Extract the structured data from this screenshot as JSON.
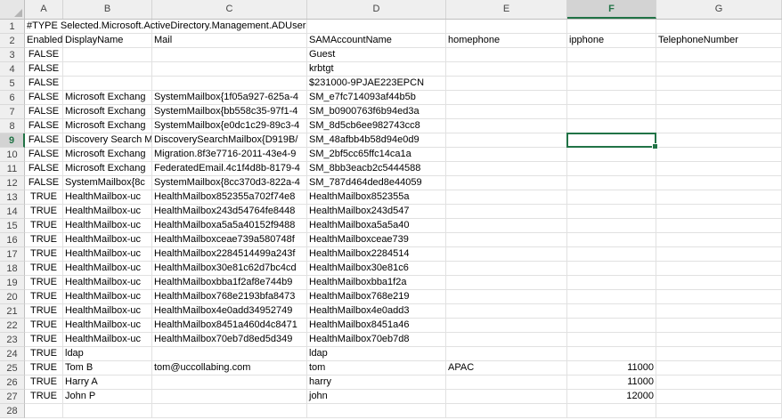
{
  "columns": [
    "A",
    "B",
    "C",
    "D",
    "E",
    "F",
    "G"
  ],
  "selected_cell": {
    "column": "F",
    "row": 9
  },
  "rows": [
    {
      "n": "1",
      "cells": [
        "#TYPE Selected.Microsoft.ActiveDirectory.Management.ADUser",
        "",
        "",
        "",
        "",
        "",
        ""
      ]
    },
    {
      "n": "2",
      "cells": [
        "Enabled",
        "DisplayName",
        "Mail",
        "SAMAccountName",
        "homephone",
        "ipphone",
        "TelephoneNumber"
      ]
    },
    {
      "n": "3",
      "cells": [
        "FALSE",
        "",
        "",
        "Guest",
        "",
        "",
        ""
      ]
    },
    {
      "n": "4",
      "cells": [
        "FALSE",
        "",
        "",
        "krbtgt",
        "",
        "",
        ""
      ]
    },
    {
      "n": "5",
      "cells": [
        "FALSE",
        "",
        "",
        "$231000-9PJAE223EPCN",
        "",
        "",
        ""
      ]
    },
    {
      "n": "6",
      "cells": [
        "FALSE",
        "Microsoft Exchang",
        "SystemMailbox{1f05a927-625a-4",
        "SM_e7fc714093af44b5b",
        "",
        "",
        ""
      ]
    },
    {
      "n": "7",
      "cells": [
        "FALSE",
        "Microsoft Exchang",
        "SystemMailbox{bb558c35-97f1-4",
        "SM_b0900763f6b94ed3a",
        "",
        "",
        ""
      ]
    },
    {
      "n": "8",
      "cells": [
        "FALSE",
        "Microsoft Exchang",
        "SystemMailbox{e0dc1c29-89c3-4",
        "SM_8d5cb6ee982743cc8",
        "",
        "",
        ""
      ]
    },
    {
      "n": "9",
      "cells": [
        "FALSE",
        "Discovery Search M",
        "DiscoverySearchMailbox{D919B/",
        "SM_48afbb4b58d94e0d9",
        "",
        "",
        ""
      ]
    },
    {
      "n": "10",
      "cells": [
        "FALSE",
        "Microsoft Exchang",
        "Migration.8f3e7716-2011-43e4-9",
        "SM_2bf5cc65ffc14ca1a",
        "",
        "",
        ""
      ]
    },
    {
      "n": "11",
      "cells": [
        "FALSE",
        "Microsoft Exchang",
        "FederatedEmail.4c1f4d8b-8179-4",
        "SM_8bb3eacb2c5444588",
        "",
        "",
        ""
      ]
    },
    {
      "n": "12",
      "cells": [
        "FALSE",
        "SystemMailbox{8c",
        "SystemMailbox{8cc370d3-822a-4",
        "SM_787d464ded8e44059",
        "",
        "",
        ""
      ]
    },
    {
      "n": "13",
      "cells": [
        "TRUE",
        "HealthMailbox-uc",
        "HealthMailbox852355a702f74e8",
        "HealthMailbox852355a",
        "",
        "",
        ""
      ]
    },
    {
      "n": "14",
      "cells": [
        "TRUE",
        "HealthMailbox-uc",
        "HealthMailbox243d54764fe8448",
        "HealthMailbox243d547",
        "",
        "",
        ""
      ]
    },
    {
      "n": "15",
      "cells": [
        "TRUE",
        "HealthMailbox-uc",
        "HealthMailboxa5a5a40152f9488",
        "HealthMailboxa5a5a40",
        "",
        "",
        ""
      ]
    },
    {
      "n": "16",
      "cells": [
        "TRUE",
        "HealthMailbox-uc",
        "HealthMailboxceae739a580748f",
        "HealthMailboxceae739",
        "",
        "",
        ""
      ]
    },
    {
      "n": "17",
      "cells": [
        "TRUE",
        "HealthMailbox-uc",
        "HealthMailbox2284514499a243f",
        "HealthMailbox2284514",
        "",
        "",
        ""
      ]
    },
    {
      "n": "18",
      "cells": [
        "TRUE",
        "HealthMailbox-uc",
        "HealthMailbox30e81c62d7bc4cd",
        "HealthMailbox30e81c6",
        "",
        "",
        ""
      ]
    },
    {
      "n": "19",
      "cells": [
        "TRUE",
        "HealthMailbox-uc",
        "HealthMailboxbba1f2af8e744b9",
        "HealthMailboxbba1f2a",
        "",
        "",
        ""
      ]
    },
    {
      "n": "20",
      "cells": [
        "TRUE",
        "HealthMailbox-uc",
        "HealthMailbox768e2193bfa8473",
        "HealthMailbox768e219",
        "",
        "",
        ""
      ]
    },
    {
      "n": "21",
      "cells": [
        "TRUE",
        "HealthMailbox-uc",
        "HealthMailbox4e0add34952749",
        "HealthMailbox4e0add3",
        "",
        "",
        ""
      ]
    },
    {
      "n": "22",
      "cells": [
        "TRUE",
        "HealthMailbox-uc",
        "HealthMailbox8451a460d4c8471",
        "HealthMailbox8451a46",
        "",
        "",
        ""
      ]
    },
    {
      "n": "23",
      "cells": [
        "TRUE",
        "HealthMailbox-uc",
        "HealthMailbox70eb7d8ed5d349",
        "HealthMailbox70eb7d8",
        "",
        "",
        ""
      ]
    },
    {
      "n": "24",
      "cells": [
        "TRUE",
        "ldap",
        "",
        "ldap",
        "",
        "",
        ""
      ]
    },
    {
      "n": "25",
      "cells": [
        "TRUE",
        "Tom B",
        "tom@uccollabing.com",
        "tom",
        "APAC",
        "11000",
        ""
      ]
    },
    {
      "n": "26",
      "cells": [
        "TRUE",
        "Harry A",
        "",
        "harry",
        "",
        "11000",
        ""
      ]
    },
    {
      "n": "27",
      "cells": [
        "TRUE",
        "John P",
        "",
        "john",
        "",
        "12000",
        ""
      ]
    },
    {
      "n": "28",
      "cells": [
        "",
        "",
        "",
        "",
        "",
        "",
        ""
      ]
    }
  ],
  "colors": {
    "accent": "#217346",
    "grid": "#e1e1e1",
    "header_bg": "#efefef"
  }
}
